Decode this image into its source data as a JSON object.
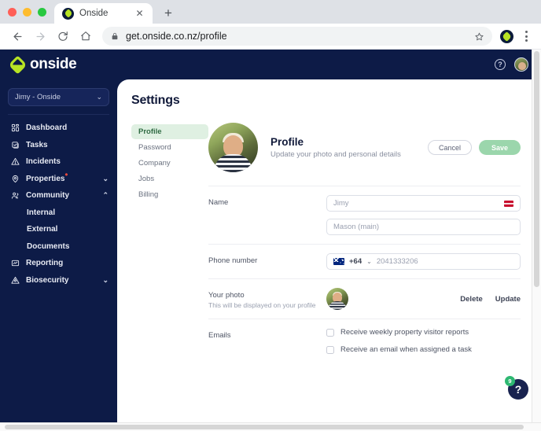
{
  "browser": {
    "tab": {
      "title": "Onside",
      "favicon_icon": "onside-leaf-icon",
      "close_icon": "close-icon"
    },
    "new_tab_label": "+",
    "nav": {
      "back_icon": "back-arrow-icon",
      "forward_icon": "forward-arrow-icon",
      "reload_icon": "reload-icon",
      "home_icon": "home-icon"
    },
    "omnibox": {
      "url": "get.onside.co.nz/profile",
      "lock_icon": "lock-icon",
      "bookmark_icon": "star-icon"
    },
    "extension_icon": "onside-extension-icon",
    "menu_icon": "kebab-menu-icon"
  },
  "appbar": {
    "brand": "onside",
    "help_icon": "help-circle-icon",
    "avatar_icon": "user-avatar"
  },
  "sidebar": {
    "org_selector": {
      "label": "Jimy - Onside",
      "chevron": "⌄"
    },
    "items": [
      {
        "label": "Dashboard",
        "icon": "dashboard-icon",
        "expandable": false
      },
      {
        "label": "Tasks",
        "icon": "tasks-icon",
        "expandable": false
      },
      {
        "label": "Incidents",
        "icon": "incidents-icon",
        "expandable": false
      },
      {
        "label": "Properties",
        "icon": "properties-pin-icon",
        "expandable": true,
        "badge_dot": true,
        "arrow": "⌄"
      },
      {
        "label": "Community",
        "icon": "community-people-icon",
        "expandable": true,
        "expanded": true,
        "arrow": "⌃"
      },
      {
        "label": "Reporting",
        "icon": "reporting-icon",
        "expandable": false
      },
      {
        "label": "Biosecurity",
        "icon": "biosecurity-icon",
        "expandable": true,
        "arrow": "⌄"
      }
    ],
    "community_subitems": [
      "Internal",
      "External",
      "Documents"
    ]
  },
  "settings": {
    "page_title": "Settings",
    "nav_items": [
      "Profile",
      "Password",
      "Company",
      "Jobs",
      "Billing"
    ],
    "active_nav": "Profile"
  },
  "profile": {
    "heading": "Profile",
    "subheading": "Update your photo and personal details",
    "cancel_label": "Cancel",
    "save_label": "Save",
    "name": {
      "label": "Name",
      "first_value": "Jimy",
      "last_value": "Mason (main)",
      "badge_icon": "red-flag-icon"
    },
    "phone": {
      "label": "Phone number",
      "country_flag": "new-zealand-flag-icon",
      "country_code": "+64",
      "chevron": "⌄",
      "value": "2041333206"
    },
    "photo": {
      "label": "Your photo",
      "sublabel": "This will be displayed on your profile",
      "delete_label": "Delete",
      "update_label": "Update"
    },
    "emails": {
      "label": "Emails",
      "options": [
        {
          "label": "Receive weekly property visitor reports",
          "checked": false
        },
        {
          "label": "Receive an email when assigned a task",
          "checked": false
        }
      ]
    }
  },
  "help_widget": {
    "icon": "question-mark-icon",
    "badge_count": "9"
  },
  "colors": {
    "navy": "#0d1b47",
    "accent_green": "#b7e324",
    "save_green": "#9bd6ac",
    "active_pill": "#dff0e2",
    "badge_green": "#2eb872",
    "alert_red": "#ef4b3c"
  }
}
